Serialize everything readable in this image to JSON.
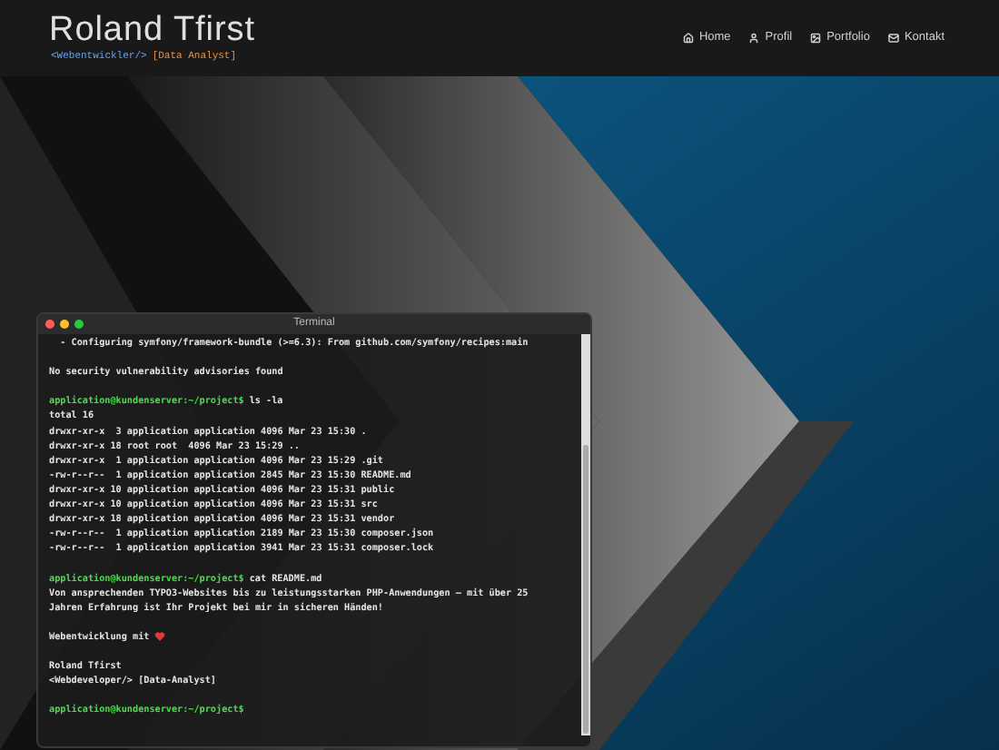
{
  "header": {
    "title": "Roland Tfirst",
    "tagline_code": "<Webentwickler/>",
    "tagline_role": "[Data Analyst]"
  },
  "nav": [
    {
      "label": "Home",
      "kind": "home"
    },
    {
      "label": "Profil",
      "kind": "user"
    },
    {
      "label": "Portfolio",
      "kind": "image"
    },
    {
      "label": "Kontakt",
      "kind": "mail"
    }
  ],
  "terminal": {
    "title": "Terminal",
    "lines": [
      {
        "kind": "output",
        "text": "  - Configuring symfony/framework-bundle (>=6.3): From github.com/symfony/recipes:main"
      },
      {
        "kind": "blank"
      },
      {
        "kind": "output",
        "text": "No security vulnerability advisories found"
      },
      {
        "kind": "blank"
      },
      {
        "kind": "prompt",
        "prompt": "application@kundenserver:~/project$",
        "text": "ls -la"
      },
      {
        "kind": "output",
        "text": "total 16"
      },
      {
        "kind": "output",
        "text": "drwxr-xr-x  3 application application 4096 Mar 23 15:30 ."
      },
      {
        "kind": "output",
        "text": "drwxr-xr-x 18 root root  4096 Mar 23 15:29 .."
      },
      {
        "kind": "output",
        "text": "drwxr-xr-x  1 application application 4096 Mar 23 15:29 .git"
      },
      {
        "kind": "output",
        "text": "-rw-r--r--  1 application application 2845 Mar 23 15:30 README.md"
      },
      {
        "kind": "output",
        "text": "drwxr-xr-x 10 application application 4096 Mar 23 15:31 public"
      },
      {
        "kind": "output",
        "text": "drwxr-xr-x 10 application application 4096 Mar 23 15:31 src"
      },
      {
        "kind": "output",
        "text": "drwxr-xr-x 18 application application 4096 Mar 23 15:31 vendor"
      },
      {
        "kind": "output",
        "text": "-rw-r--r--  1 application application 2189 Mar 23 15:30 composer.json"
      },
      {
        "kind": "output",
        "text": "-rw-r--r--  1 application application 3941 Mar 23 15:31 composer.lock"
      },
      {
        "kind": "blank"
      },
      {
        "kind": "prompt",
        "prompt": "application@kundenserver:~/project$",
        "text": "cat README.md"
      },
      {
        "kind": "output",
        "text": "Von ansprechenden TYPO3-Websites bis zu leistungsstarken PHP-Anwendungen – mit über 25"
      },
      {
        "kind": "output",
        "text": "Jahren Erfahrung ist Ihr Projekt bei mir in sicheren Händen!"
      },
      {
        "kind": "blank"
      },
      {
        "kind": "heart",
        "text": "Webentwicklung mit"
      },
      {
        "kind": "blank"
      },
      {
        "kind": "output",
        "text": "Roland Tfirst"
      },
      {
        "kind": "output",
        "text": "<Webdeveloper/> [Data-Analyst]"
      },
      {
        "kind": "blank"
      },
      {
        "kind": "prompt",
        "prompt": "application@kundenserver:~/project$"
      }
    ]
  }
}
